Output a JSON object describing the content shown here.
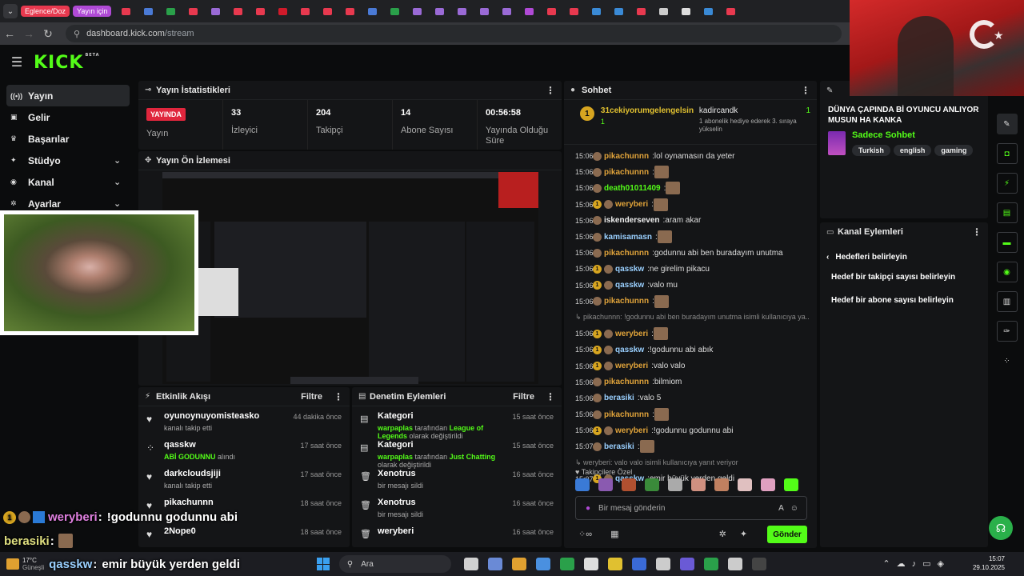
{
  "browser": {
    "group1": "Eglence/Doz",
    "group2": "Yayın için",
    "url_host": "dashboard.kick.com",
    "url_path": "/stream"
  },
  "colors": {
    "accent": "#53fc18",
    "live": "#e0263d",
    "gold": "#d7a520"
  },
  "sidebar": {
    "items": [
      {
        "label": "Yayın",
        "icon": "broadcast-icon",
        "active": true
      },
      {
        "label": "Gelir",
        "icon": "money-icon"
      },
      {
        "label": "Başarılar",
        "icon": "trophy-icon"
      },
      {
        "label": "Stüdyo",
        "icon": "studio-icon",
        "chevron": true
      },
      {
        "label": "Kanal",
        "icon": "channel-icon",
        "chevron": true
      },
      {
        "label": "Ayarlar",
        "icon": "gear-icon",
        "chevron": true
      }
    ]
  },
  "stats": {
    "title": "Yayın İstatistikleri",
    "live_badge": "YAYINDA",
    "live_label": "Yayın",
    "viewers": "33",
    "viewers_label": "İzleyici",
    "followers": "204",
    "followers_label": "Takipçi",
    "subs": "14",
    "subs_label": "Abone Sayısı",
    "uptime": "00:56:58",
    "uptime_label": "Yayında Olduğu Süre"
  },
  "preview": {
    "title": "Yayın Ön İzlemesi"
  },
  "activity": {
    "title": "Etkinlik Akışı",
    "filter": "Filtre",
    "rows": [
      {
        "name": "oyunoynuyomisteasko",
        "sub": "kanalı takip etti",
        "time": "44 dakika önce"
      },
      {
        "name": "qasskw",
        "sub_hl": "ABİ GODUNNU",
        "sub": "alındı",
        "time": "17 saat önce"
      },
      {
        "name": "darkcloudsjiji",
        "sub": "kanalı takip etti",
        "time": "17 saat önce"
      },
      {
        "name": "pikachunnn",
        "sub": "",
        "time": "18 saat önce"
      },
      {
        "name": "2Nope0",
        "sub": "",
        "time": "18 saat önce"
      }
    ]
  },
  "moderation": {
    "title": "Denetim Eylemleri",
    "filter": "Filtre",
    "rows": [
      {
        "name": "Kategori",
        "who": "warpaplas",
        "mid": "tarafından",
        "hl": "League of Legends",
        "rest": "olarak değiştirildi",
        "time": "15 saat önce"
      },
      {
        "name": "Kategori",
        "who": "warpaplas",
        "mid": "tarafından",
        "hl": "Just Chatting",
        "rest": "olarak değiştirildi",
        "time": "15 saat önce"
      },
      {
        "name": "Xenotrus",
        "sub": "bir mesajı sildi",
        "time": "16 saat önce"
      },
      {
        "name": "Xenotrus",
        "sub": "bir mesajı sildi",
        "time": "16 saat önce"
      },
      {
        "name": "weryberi",
        "sub": "",
        "time": "16 saat önce"
      }
    ]
  },
  "chat": {
    "title": "Sohbet",
    "pinned_user": "31cekiyorumgelengelsin",
    "pinned_count": "1",
    "gift_user": "kadircandk",
    "gift_count": "1",
    "gift_text": "1 abonelik hediye ederek 3. sıraya yükselin",
    "messages": [
      {
        "t": "15:06",
        "u": "pikachunnn",
        "c": "#e0a33a",
        "m": "lol oynamasın da yeter"
      },
      {
        "t": "15:06",
        "u": "pikachunnn",
        "c": "#e0a33a",
        "m": "",
        "em": true
      },
      {
        "t": "15:06",
        "u": "death01011409",
        "c": "#53fc18",
        "m": "",
        "em": true
      },
      {
        "t": "15:06",
        "u": "weryberi",
        "c": "#e0a33a",
        "m": "",
        "em": true,
        "b": true
      },
      {
        "t": "15:06",
        "u": "iskenderseven",
        "c": "#eeeeee",
        "m": "aram akar"
      },
      {
        "t": "15:06",
        "u": "kamisamasn",
        "c": "#9ad0ff",
        "m": "",
        "em": true
      },
      {
        "t": "15:06",
        "u": "pikachunnn",
        "c": "#e0a33a",
        "m": "godunnu abi ben buradayım unutma"
      },
      {
        "t": "15:06",
        "u": "qasskw",
        "c": "#9ad0ff",
        "m": "ne girelim pikacu",
        "b": true
      },
      {
        "t": "15:06",
        "u": "qasskw",
        "c": "#9ad0ff",
        "m": "valo mu",
        "b": true
      },
      {
        "t": "15:06",
        "u": "pikachunnn",
        "c": "#e0a33a",
        "m": "",
        "em": true
      },
      {
        "t": "",
        "u": "",
        "c": "#888888",
        "m": "↳ pikachunnn: !godunnu abi ben buradayım unutma isimli kullanıcıya ya...",
        "sys": true
      },
      {
        "t": "15:06",
        "u": "weryberi",
        "c": "#e0a33a",
        "m": "",
        "em": true,
        "b": true
      },
      {
        "t": "15:06",
        "u": "qasskw",
        "c": "#9ad0ff",
        "m": "!godunnu abi abık",
        "b": true
      },
      {
        "t": "15:06",
        "u": "weryberi",
        "c": "#e0a33a",
        "m": "valo valo",
        "b": true
      },
      {
        "t": "15:06",
        "u": "pikachunnn",
        "c": "#e0a33a",
        "m": "bilmiom"
      },
      {
        "t": "15:06",
        "u": "berasiki",
        "c": "#9ad0ff",
        "m": "valo 5"
      },
      {
        "t": "15:06",
        "u": "pikachunnn",
        "c": "#e0a33a",
        "m": "",
        "em": true
      },
      {
        "t": "15:06",
        "u": "weryberi",
        "c": "#e0a33a",
        "m": "!godunnu godunnu abi",
        "b": true
      },
      {
        "t": "15:07",
        "u": "berasiki",
        "c": "#9ad0ff",
        "m": "",
        "em": true
      },
      {
        "t": "",
        "u": "",
        "c": "#888888",
        "m": "↳ weryberi: valo valo isimli kullanıcıya yanıt veriyor",
        "sys": true
      },
      {
        "t": "15:07",
        "u": "qasskw",
        "c": "#9ad0ff",
        "m": "emir büyük yerden geldi",
        "b": true
      }
    ],
    "followers_only": "Takipçilere Özel",
    "placeholder": "Bir mesaj gönderin",
    "send": "Gönder"
  },
  "stream_info": {
    "title": "DÜNYA ÇAPINDA Bİ OYUNCU ANLIYOR MUSUN HA KANKA",
    "category": "Sadece Sohbet",
    "tags": [
      "Turkish",
      "english",
      "gaming"
    ]
  },
  "channel_actions": {
    "title": "Kanal Eylemleri",
    "back": "Hedefleri belirleyin",
    "items": [
      "Hedef bir takipçi sayısı belirleyin",
      "Hedef bir abone sayısı belirleyin"
    ]
  },
  "overlay": {
    "line1_user": "weryberi",
    "line1_msg": "!godunnu godunnu abi",
    "line2_user": "berasiki",
    "line3_user": "qasskw",
    "line3_msg": "emir büyük yerden geldi"
  },
  "taskbar": {
    "search": "Ara",
    "weather_temp": "17°C",
    "weather_desc": "Güneşli",
    "time": "15:07",
    "date": "29.10.2025"
  }
}
